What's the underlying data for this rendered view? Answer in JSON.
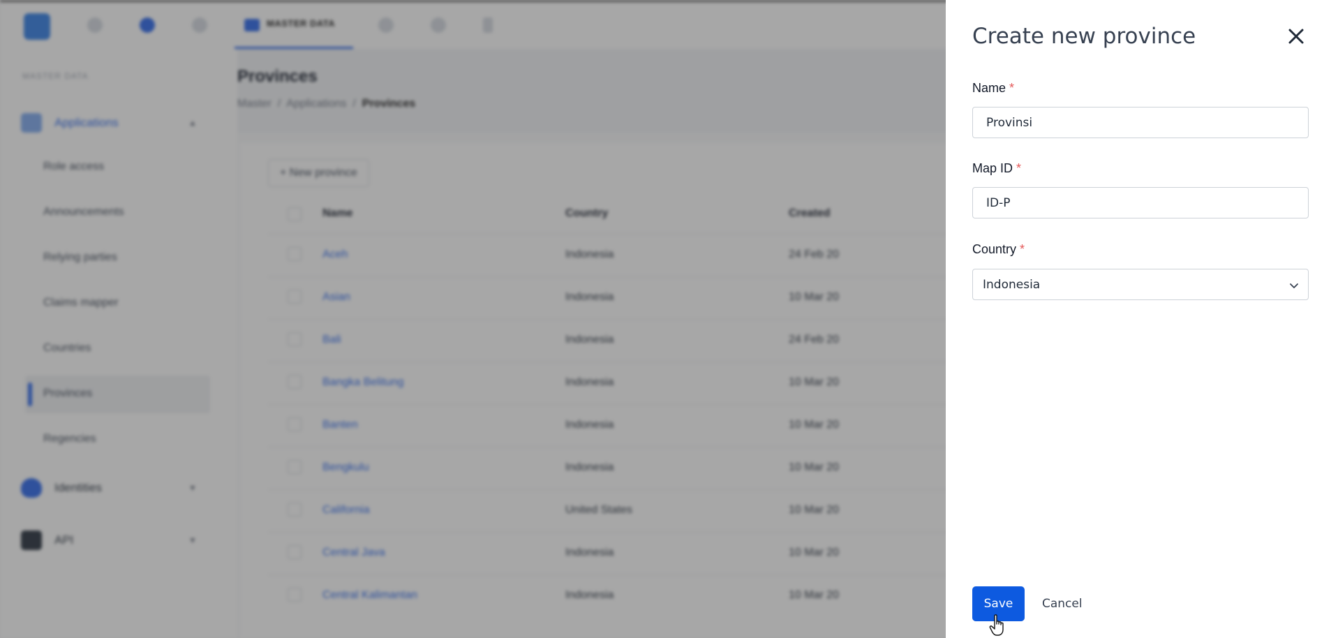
{
  "topbar": {
    "active_tab_label": "MASTER DATA"
  },
  "sidebar": {
    "section_label": "MASTER DATA",
    "groups": [
      {
        "label": "Applications"
      },
      {
        "label": "Identities"
      },
      {
        "label": "API"
      }
    ],
    "items": [
      {
        "label": "Role access"
      },
      {
        "label": "Announcements"
      },
      {
        "label": "Relying parties"
      },
      {
        "label": "Claims mapper"
      },
      {
        "label": "Countries"
      },
      {
        "label": "Provinces"
      },
      {
        "label": "Regencies"
      }
    ]
  },
  "page": {
    "title": "Provinces",
    "breadcrumb": [
      "Master",
      "Applications",
      "Provinces"
    ],
    "new_button": "+ New province"
  },
  "table": {
    "headers": [
      "Name",
      "Country",
      "Created"
    ],
    "rows": [
      {
        "name": "Aceh",
        "country": "Indonesia",
        "created": "24 Feb 20"
      },
      {
        "name": "Asian",
        "country": "Indonesia",
        "created": "10 Mar 20"
      },
      {
        "name": "Bali",
        "country": "Indonesia",
        "created": "24 Feb 20"
      },
      {
        "name": "Bangka Belitung",
        "country": "Indonesia",
        "created": "10 Mar 20"
      },
      {
        "name": "Banten",
        "country": "Indonesia",
        "created": "10 Mar 20"
      },
      {
        "name": "Bengkulu",
        "country": "Indonesia",
        "created": "10 Mar 20"
      },
      {
        "name": "California",
        "country": "United States",
        "created": "10 Mar 20"
      },
      {
        "name": "Central Java",
        "country": "Indonesia",
        "created": "10 Mar 20"
      },
      {
        "name": "Central Kalimantan",
        "country": "Indonesia",
        "created": "10 Mar 20"
      }
    ]
  },
  "drawer": {
    "title": "Create new province",
    "required_mark": "*",
    "fields": {
      "name": {
        "label": "Name",
        "value": "Provinsi"
      },
      "map_id": {
        "label": "Map ID",
        "value": "ID-P"
      },
      "country": {
        "label": "Country",
        "value": "Indonesia"
      }
    },
    "save_label": "Save",
    "cancel_label": "Cancel"
  },
  "colors": {
    "primary": "#0d5ae0",
    "required": "#e45858"
  }
}
